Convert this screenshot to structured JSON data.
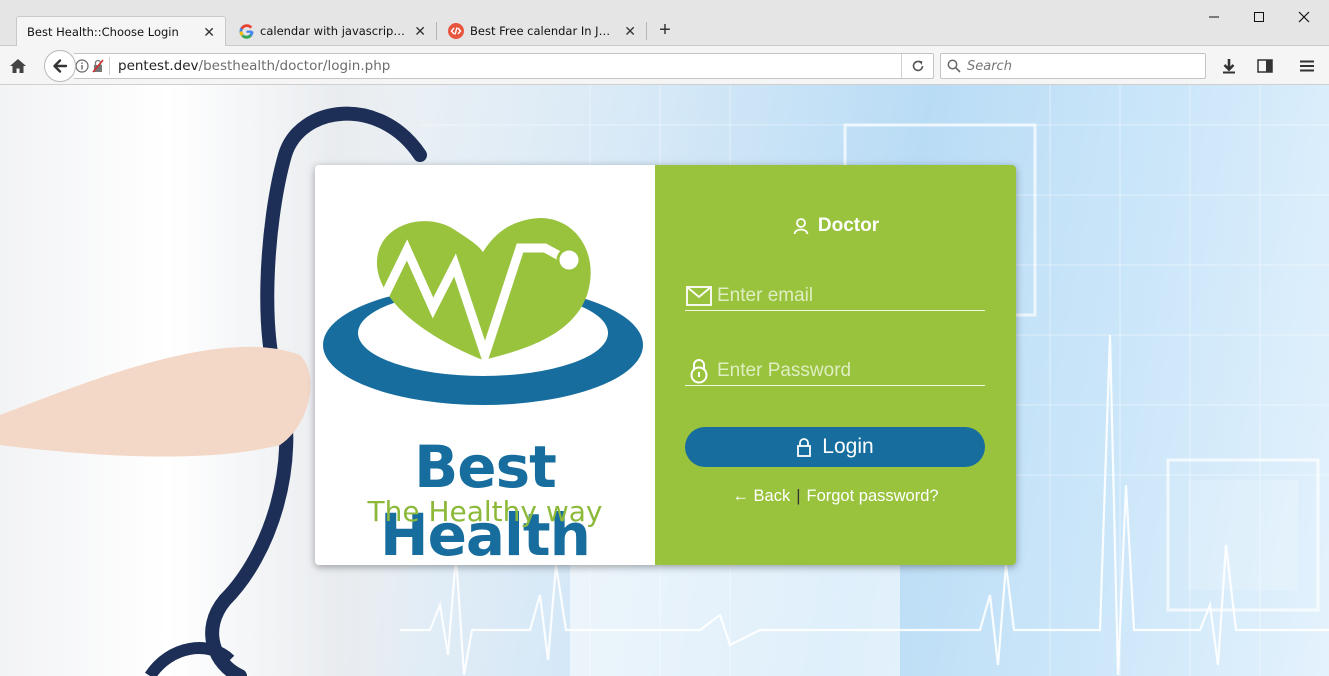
{
  "browser": {
    "tabs": [
      {
        "title": "Best Health::Choose Login",
        "active": true,
        "icon": "none"
      },
      {
        "title": "calendar with javascript - ...",
        "active": false,
        "icon": "google-icon"
      },
      {
        "title": "Best Free calendar In JavaS...",
        "active": false,
        "icon": "code-icon"
      }
    ],
    "new_tab": "+",
    "url": {
      "host": "pentest.dev",
      "path": "/besthealth/doctor/login.php"
    },
    "search_placeholder": "Search"
  },
  "brand": {
    "name": "Best Health",
    "tagline": "The Healthy way",
    "colors": {
      "blue": "#176e9e",
      "green": "#99c23d",
      "tagline": "#8cb93a"
    }
  },
  "login": {
    "role": "Doctor",
    "email_placeholder": "Enter email",
    "password_placeholder": "Enter Password",
    "login_label": "Login",
    "back_label": "Back",
    "forgot_label": "Forgot password?",
    "separator": "|"
  }
}
